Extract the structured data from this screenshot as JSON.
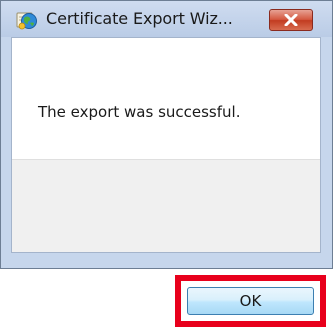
{
  "window": {
    "title": "Certificate Export Wiz...",
    "icon": "certificate-globe-icon",
    "close_icon": "close-icon"
  },
  "dialog": {
    "message": "The export was successful.",
    "ok_label": "OK"
  },
  "colors": {
    "highlight": "#e8001c",
    "close_button": "#c9432a",
    "frame": "#c6d6ec"
  }
}
